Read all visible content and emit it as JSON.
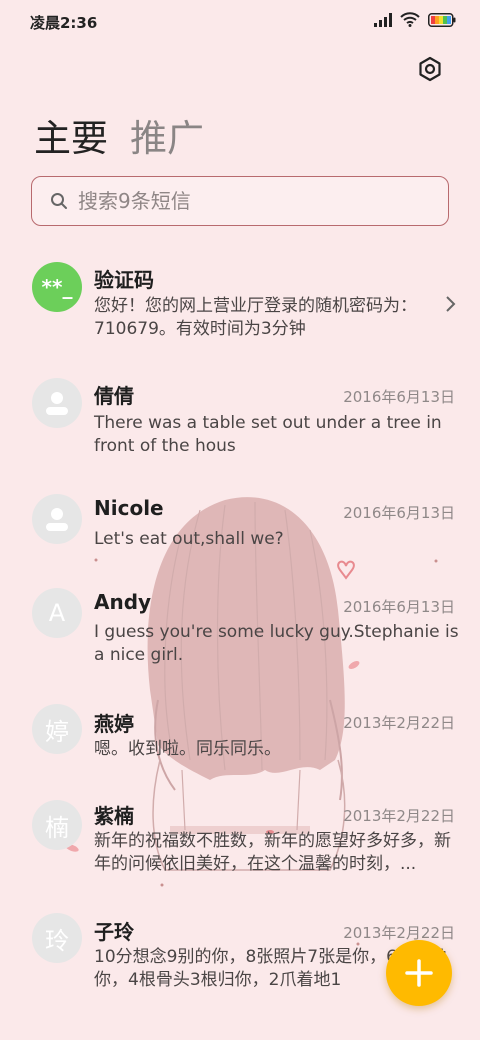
{
  "status_bar": {
    "time": "凌晨2:36",
    "icons": [
      "signal-icon",
      "wifi-icon",
      "battery-icon"
    ]
  },
  "header": {
    "settings_icon": "gear-icon",
    "tabs": [
      {
        "label": "主要",
        "active": true
      },
      {
        "label": "推广",
        "active": false
      }
    ]
  },
  "search": {
    "placeholder": "搜索9条短信",
    "value": ""
  },
  "messages": [
    {
      "name": "验证码",
      "avatar": "**_",
      "avatar_color": "#6ccf5a",
      "date": "",
      "body": "您好！您的网上营业厅登录的随机密码为：710679。有效时间为3分钟",
      "has_chevron": true
    },
    {
      "name": "倩倩",
      "avatar": "person-icon",
      "date": "2016年6月13日",
      "body": "There was a table set out under a tree in front of the hous"
    },
    {
      "name": "Nicole",
      "avatar": "person-icon",
      "date": "2016年6月13日",
      "body": "Let's eat out,shall we?"
    },
    {
      "name": "Andy",
      "avatar": "A",
      "date": "2016年6月13日",
      "body": "I guess you're some lucky guy.Stephanie is a nice girl."
    },
    {
      "name": "燕婷",
      "avatar": "婷",
      "date": "2013年2月22日",
      "body": "嗯。收到啦。同乐同乐。"
    },
    {
      "name": "紫楠",
      "avatar": "楠",
      "date": "2013年2月22日",
      "body": "新年的祝福数不胜数，新年的愿望好多好多，新年的问候依旧美好，在这个温馨的时刻，..."
    },
    {
      "name": "子玲",
      "avatar": "玲",
      "date": "2013年2月22日",
      "body": "10分想念9别的你，8张照片7张是你，6 5只像你，4根骨头3根归你，2爪着地1"
    }
  ],
  "fab": {
    "icon": "plus-icon",
    "color": "#ffba00"
  },
  "colors": {
    "background": "#fbe9ea",
    "search_border": "#b86a6e",
    "accent": "#ffba00"
  }
}
